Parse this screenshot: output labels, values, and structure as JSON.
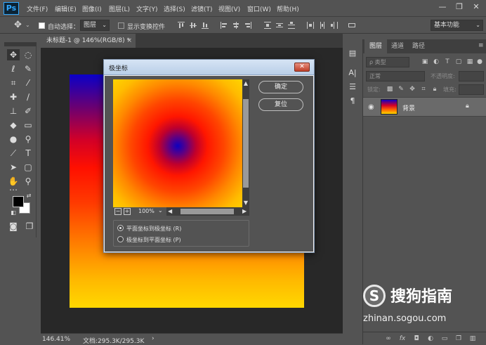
{
  "app": {
    "logo": "Ps"
  },
  "menu": [
    "文件(F)",
    "编辑(E)",
    "图像(I)",
    "图层(L)",
    "文字(Y)",
    "选择(S)",
    "滤镜(T)",
    "视图(V)",
    "窗口(W)",
    "帮助(H)"
  ],
  "window_controls": {
    "minimize": "—",
    "restore": "❐",
    "close": "✕"
  },
  "options_bar": {
    "move_tool_icon": "move-icon",
    "auto_select_label": "自动选择：",
    "auto_select_value": "图层",
    "show_transform_label": "显示变换控件",
    "workspace": "基本功能"
  },
  "document": {
    "tab_title": "未标题-1 @ 146%(RGB/8) *",
    "tab_close": "×",
    "status_zoom": "146.41%",
    "status_doc": "文档:295.3K/295.3K"
  },
  "dialog": {
    "title": "极坐标",
    "close_label": "✕",
    "ok_label": "确定",
    "reset_label": "复位",
    "zoom_value": "100%",
    "zoom_out": "−",
    "zoom_in": "+",
    "options": [
      {
        "label": "平面坐标到极坐标 (R)",
        "checked": true
      },
      {
        "label": "极坐标到平面坐标 (P)",
        "checked": false
      }
    ]
  },
  "layers_panel": {
    "tabs": [
      "图层",
      "通道",
      "路径"
    ],
    "filter_kind": "ρ 类型",
    "blend_mode": "正常",
    "opacity_label": "不透明度:",
    "lock_label": "锁定:",
    "fill_label": "填充:",
    "layer_name": "背景"
  },
  "watermark": {
    "logo": "S",
    "text": "搜狗指南",
    "url": "zhinan.sogou.com"
  }
}
